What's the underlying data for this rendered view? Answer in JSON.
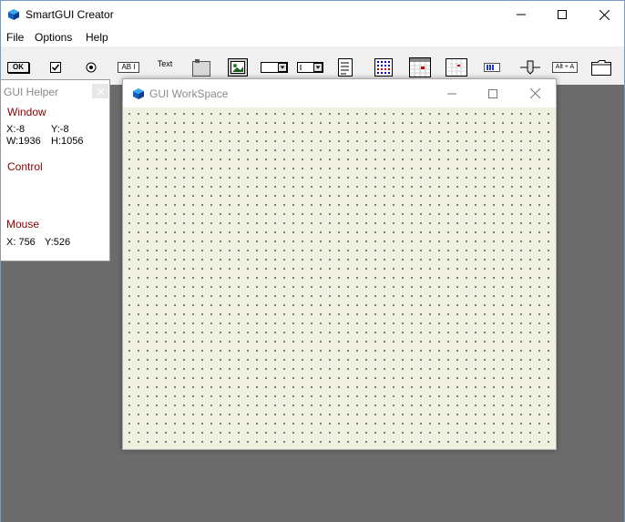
{
  "app": {
    "title": "SmartGUI Creator"
  },
  "menu": [
    "File",
    "Options",
    "Help"
  ],
  "toolbar": {
    "ok_label": "OK",
    "edit_label": "AB I",
    "text_label": "Text",
    "hotkey_label": "Alt + A"
  },
  "helper": {
    "title": "GUI Helper",
    "window_heading": "Window",
    "window_x": "X:-8",
    "window_y": "Y:-8",
    "window_w": "W:1936",
    "window_h": "H:1056",
    "control_heading": "Control",
    "mouse_heading": "Mouse",
    "mouse_x": "X: 756",
    "mouse_y": "Y:526"
  },
  "workspace": {
    "title": "GUI WorkSpace"
  },
  "colors": {
    "heading": "#8b0000",
    "canvas": "#f0f0e0",
    "desktop": "#6c6c6c",
    "accent": "#0078d7"
  }
}
